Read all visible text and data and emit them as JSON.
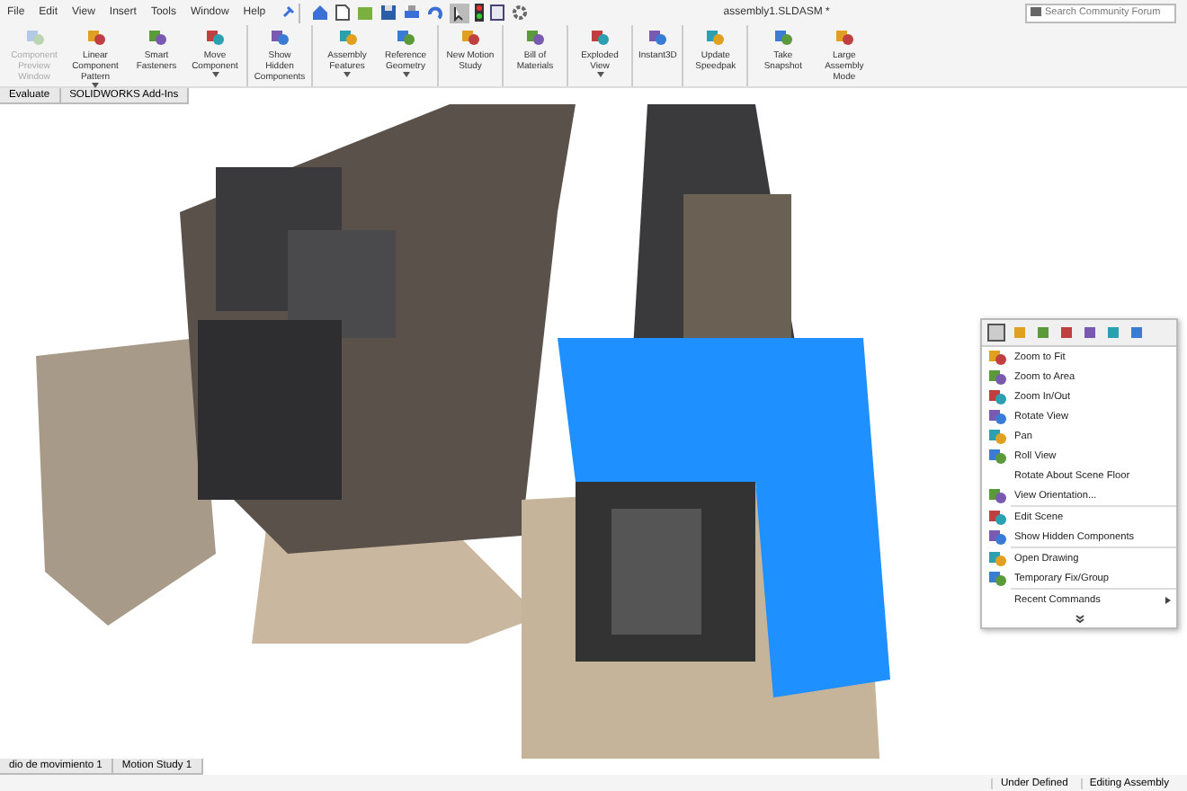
{
  "menu_bar": {
    "items": [
      "File",
      "Edit",
      "View",
      "Insert",
      "Tools",
      "Window",
      "Help"
    ]
  },
  "window": {
    "title": "assembly1.SLDASM *"
  },
  "search": {
    "placeholder": "Search Community Forum"
  },
  "ribbon": {
    "buttons": [
      {
        "label": "Component Preview Window",
        "disabled": true,
        "dropdown": false,
        "separator_after": false
      },
      {
        "label": "Linear Component Pattern",
        "disabled": false,
        "dropdown": true,
        "separator_after": false
      },
      {
        "label": "Smart Fasteners",
        "disabled": false,
        "dropdown": false,
        "separator_after": false
      },
      {
        "label": "Move Component",
        "disabled": false,
        "dropdown": true,
        "separator_after": true
      },
      {
        "label": "Show Hidden Components",
        "disabled": false,
        "dropdown": false,
        "separator_after": true
      },
      {
        "label": "Assembly Features",
        "disabled": false,
        "dropdown": true,
        "separator_after": false
      },
      {
        "label": "Reference Geometry",
        "disabled": false,
        "dropdown": true,
        "separator_after": true
      },
      {
        "label": "New Motion Study",
        "disabled": false,
        "dropdown": false,
        "separator_after": true
      },
      {
        "label": "Bill of Materials",
        "disabled": false,
        "dropdown": false,
        "separator_after": true
      },
      {
        "label": "Exploded View",
        "disabled": false,
        "dropdown": true,
        "separator_after": true
      },
      {
        "label": "Instant3D",
        "disabled": false,
        "dropdown": false,
        "separator_after": true
      },
      {
        "label": "Update Speedpak",
        "disabled": false,
        "dropdown": false,
        "separator_after": true
      },
      {
        "label": "Take Snapshot",
        "disabled": false,
        "dropdown": false,
        "separator_after": false
      },
      {
        "label": "Large Assembly Mode",
        "disabled": false,
        "dropdown": false,
        "separator_after": false
      }
    ]
  },
  "command_tabs": [
    {
      "label": "Evaluate",
      "selected": false
    },
    {
      "label": "SOLIDWORKS Add-Ins",
      "selected": false
    }
  ],
  "context_menu": {
    "groups": [
      [
        {
          "kind": "command",
          "label": "Zoom to Fit"
        },
        {
          "kind": "command",
          "label": "Zoom to Area"
        },
        {
          "kind": "command",
          "label": "Zoom In/Out"
        },
        {
          "kind": "command",
          "label": "Rotate View"
        },
        {
          "kind": "command",
          "label": "Pan"
        },
        {
          "kind": "command",
          "label": "Roll View"
        },
        {
          "kind": "command",
          "label": "Rotate About Scene Floor"
        },
        {
          "kind": "command",
          "label": "View Orientation..."
        }
      ],
      [
        {
          "kind": "command",
          "label": "Edit Scene"
        },
        {
          "kind": "command",
          "label": "Show Hidden Components"
        }
      ],
      [
        {
          "kind": "command",
          "label": "Open Drawing"
        },
        {
          "kind": "command",
          "label": "Temporary Fix/Group"
        }
      ],
      [
        {
          "kind": "submenu",
          "label": "Recent Commands"
        }
      ]
    ]
  },
  "bottom_tabs": [
    {
      "label": "dio de movimiento 1",
      "selected": false
    },
    {
      "label": "Motion Study 1",
      "selected": false
    }
  ],
  "status_bar": [
    "Under Defined",
    "Editing Assembly"
  ]
}
